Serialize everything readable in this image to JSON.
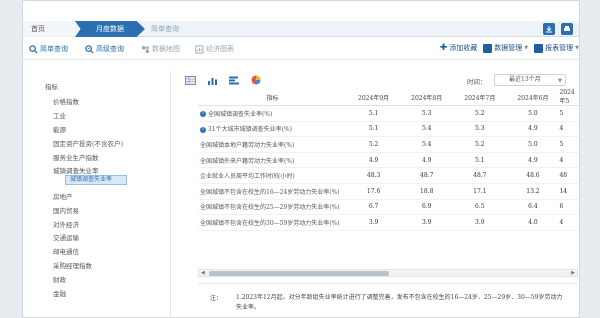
{
  "tabs": {
    "home": "首页",
    "monthly": "月度数据",
    "simple_query": "简单查询"
  },
  "toolbar": {
    "simple_query": "简单查询",
    "advanced_query": "高级查询",
    "data_map": "数据地图",
    "frequent_reports": "经济图表",
    "add_favorite": "添加收藏",
    "data_manage": "数据管理",
    "report_manage": "报表管理"
  },
  "sidebar": {
    "root": "指标",
    "items": [
      "价格指数",
      "工业",
      "能源",
      "固定资产投资(不含农户)",
      "服务业生产指数",
      "城镇调查失业率",
      "城镇调查失业率",
      "房地产",
      "国内贸易",
      "对外经济",
      "交通运输",
      "邮电通信",
      "采购经理指数",
      "财政",
      "金融"
    ]
  },
  "time": {
    "label": "时间：",
    "selected": "最近13个月"
  },
  "table": {
    "header": {
      "indicator": "指标",
      "columns": [
        "2024年9月",
        "2024年8月",
        "2024年7月",
        "2024年6月",
        "2024年5"
      ]
    },
    "rows": [
      {
        "name": "全国城镇调查失业率(%)",
        "info": true,
        "values": [
          "5.1",
          "5.3",
          "5.2",
          "5.0",
          "5"
        ]
      },
      {
        "name": "31个大城市城镇调查失业率(%)",
        "info": true,
        "values": [
          "5.1",
          "5.4",
          "5.3",
          "4.9",
          "4"
        ]
      },
      {
        "name": "全国城镇本地户籍劳动力失业率(%)",
        "info": false,
        "values": [
          "5.2",
          "5.4",
          "5.2",
          "5.0",
          "5"
        ]
      },
      {
        "name": "全国城镇外来户籍劳动力失业率(%)",
        "info": false,
        "values": [
          "4.9",
          "4.9",
          "5.1",
          "4.9",
          "4"
        ]
      },
      {
        "name": "企业就业人员周平均工作时间(小时)",
        "info": false,
        "values": [
          "48.3",
          "48.7",
          "48.7",
          "48.6",
          "48"
        ]
      },
      {
        "name": "全国城镇不包含在校生的16—24岁劳动力失业率(%)",
        "info": false,
        "values": [
          "17.6",
          "18.8",
          "17.1",
          "13.2",
          "14"
        ]
      },
      {
        "name": "全国城镇不包含在校生的25—29岁劳动力失业率(%)",
        "info": false,
        "values": [
          "6.7",
          "6.9",
          "6.5",
          "6.4",
          "6"
        ]
      },
      {
        "name": "全国城镇不包含在校生的30—59岁劳动力失业率(%)",
        "info": false,
        "values": [
          "3.9",
          "3.9",
          "3.9",
          "4.0",
          "4"
        ]
      }
    ]
  },
  "note": {
    "label": "注：",
    "text": "1.2023年12月起，对分年龄组失业率统计进行了调整完善，发布不包含在校生的16—24岁、25—29岁、30—59岁劳动力失业率。"
  }
}
